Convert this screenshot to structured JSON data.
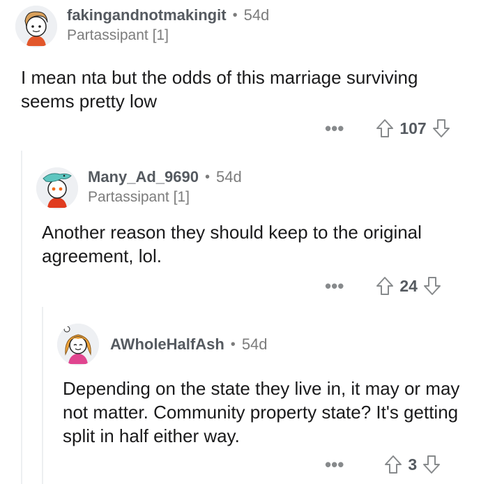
{
  "comments": [
    {
      "username": "fakingandnotmakingit",
      "age": "54d",
      "flair": "Partassipant [1]",
      "text": "I mean nta but the odds of this marriage surviving seems pretty low",
      "score": "107",
      "more": "•••"
    },
    {
      "username": "Many_Ad_9690",
      "age": "54d",
      "flair": "Partassipant [1]",
      "text": "Another reason they should keep to the original agreement, lol.",
      "score": "24",
      "more": "•••"
    },
    {
      "username": "AWholeHalfAsh",
      "age": "54d",
      "text": "Depending on the state they live in, it may or may not matter. Community property state? It's getting split in half either way.",
      "score": "3",
      "more": "•••"
    }
  ],
  "separator": "•",
  "colors": {
    "text": "#1a1a1b",
    "muted": "#7c7c7c",
    "thread_line": "#edeff1"
  }
}
